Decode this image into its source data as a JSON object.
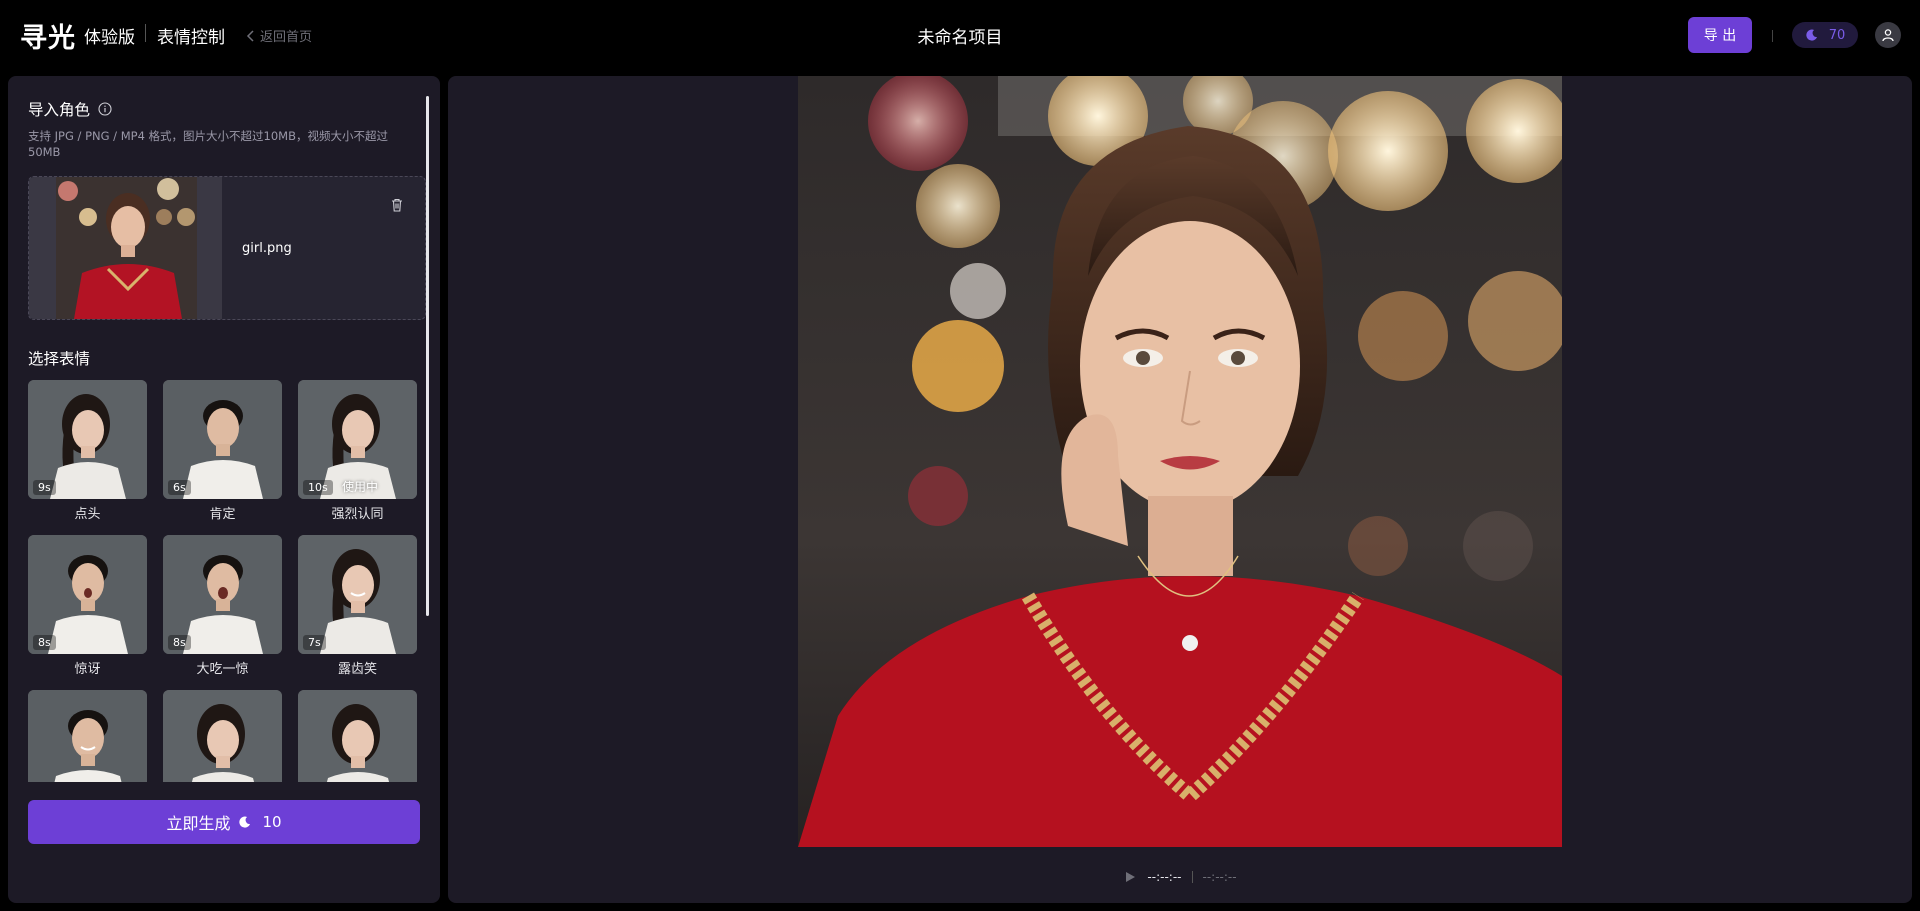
{
  "header": {
    "logo": "寻光",
    "edition": "体验版",
    "feature": "表情控制",
    "back_label": "返回首页",
    "project_title": "未命名项目",
    "export_label": "导 出",
    "credits": "70",
    "icons": {
      "back": "chevron-left-icon",
      "credits": "moon-icon",
      "avatar": "user-icon"
    },
    "accent_color": "#6d3fd6"
  },
  "sidebar": {
    "import_title": "导入角色",
    "import_hint": "支持 JPG / PNG / MP4 格式，图片大小不超过10MB，视频大小不超过50MB",
    "uploaded_file": "girl.png",
    "expressions_title": "选择表情",
    "expressions": [
      {
        "label": "点头",
        "duration": "9s",
        "subject": "woman",
        "in_use": false
      },
      {
        "label": "肯定",
        "duration": "6s",
        "subject": "man",
        "in_use": false
      },
      {
        "label": "强烈认同",
        "duration": "10s",
        "subject": "woman",
        "in_use": true,
        "in_use_label": "使用中"
      },
      {
        "label": "惊讶",
        "duration": "8s",
        "subject": "man",
        "in_use": false
      },
      {
        "label": "大吃一惊",
        "duration": "8s",
        "subject": "man",
        "in_use": false
      },
      {
        "label": "露齿笑",
        "duration": "7s",
        "subject": "woman",
        "in_use": false
      },
      {
        "label": "",
        "duration": "",
        "subject": "man",
        "in_use": false
      },
      {
        "label": "",
        "duration": "",
        "subject": "woman",
        "in_use": false
      },
      {
        "label": "",
        "duration": "",
        "subject": "woman",
        "in_use": false
      }
    ],
    "generate_label": "立即生成",
    "generate_cost": "10"
  },
  "player": {
    "current_time": "--:--:--",
    "total_time": "--:--:--"
  }
}
